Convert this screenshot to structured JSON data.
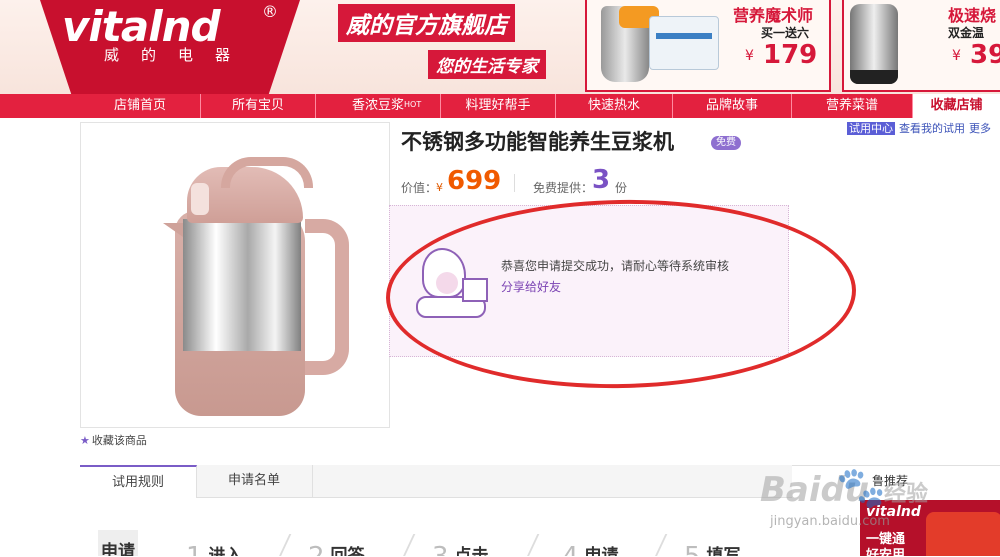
{
  "banner": {
    "logo_text": "vitalnd",
    "logo_reg": "®",
    "logo_cn": "威的电器",
    "shop_title": "威的官方旗舰店",
    "shop_subtitle": "您的生活专家",
    "promo1": {
      "title": "营养魔术师",
      "subtitle": "买一送六",
      "currency": "¥",
      "price": "179"
    },
    "promo2": {
      "title": "极速烧",
      "subtitle": "双金温",
      "currency": "¥",
      "price": "39"
    }
  },
  "nav": {
    "items": [
      {
        "label": "店铺首页"
      },
      {
        "label": "所有宝贝"
      },
      {
        "label": "香浓豆浆",
        "badge": "HOT"
      },
      {
        "label": "料理好帮手"
      },
      {
        "label": "快速热水"
      },
      {
        "label": "品牌故事"
      },
      {
        "label": "营养菜谱"
      },
      {
        "label": "收藏店铺"
      }
    ]
  },
  "trial": {
    "center": "试用中心",
    "my_trials": "查看我的试用",
    "more": "更多"
  },
  "product": {
    "title": "不锈钢多功能智能养生豆浆机",
    "free_badge": "免费",
    "price_label": "价值：",
    "currency": "¥",
    "price": "699",
    "supply_label": "免费提供：",
    "supply_count": "3",
    "supply_unit": "份",
    "favorite_label": "收藏该商品"
  },
  "success": {
    "message": "恭喜您申请提交成功，请耐心等待系统审核",
    "share_link": "分享给好友"
  },
  "tabs": [
    {
      "label": "试用规则"
    },
    {
      "label": "申请名单"
    }
  ],
  "steps": [
    {
      "label": "申请"
    },
    {
      "num": "1",
      "label": "进入"
    },
    {
      "num": "2",
      "label": "回答"
    },
    {
      "num": "3",
      "label": "点击"
    },
    {
      "num": "4",
      "label": "申请"
    },
    {
      "num": "5",
      "label": "填写"
    }
  ],
  "right_panel": {
    "title": "鲁推荐",
    "ad_logo": "vitalnd",
    "ad_line1": "一键通",
    "ad_line2": "好安用"
  },
  "watermark": {
    "logo": "Baidu",
    "cn": "经验",
    "url": "jingyan.baidu.com"
  },
  "colors": {
    "brand_red": "#e3213f",
    "accent_purple": "#7a5cc7",
    "price_orange": "#f05a00",
    "circle_red": "#e02b2b"
  }
}
